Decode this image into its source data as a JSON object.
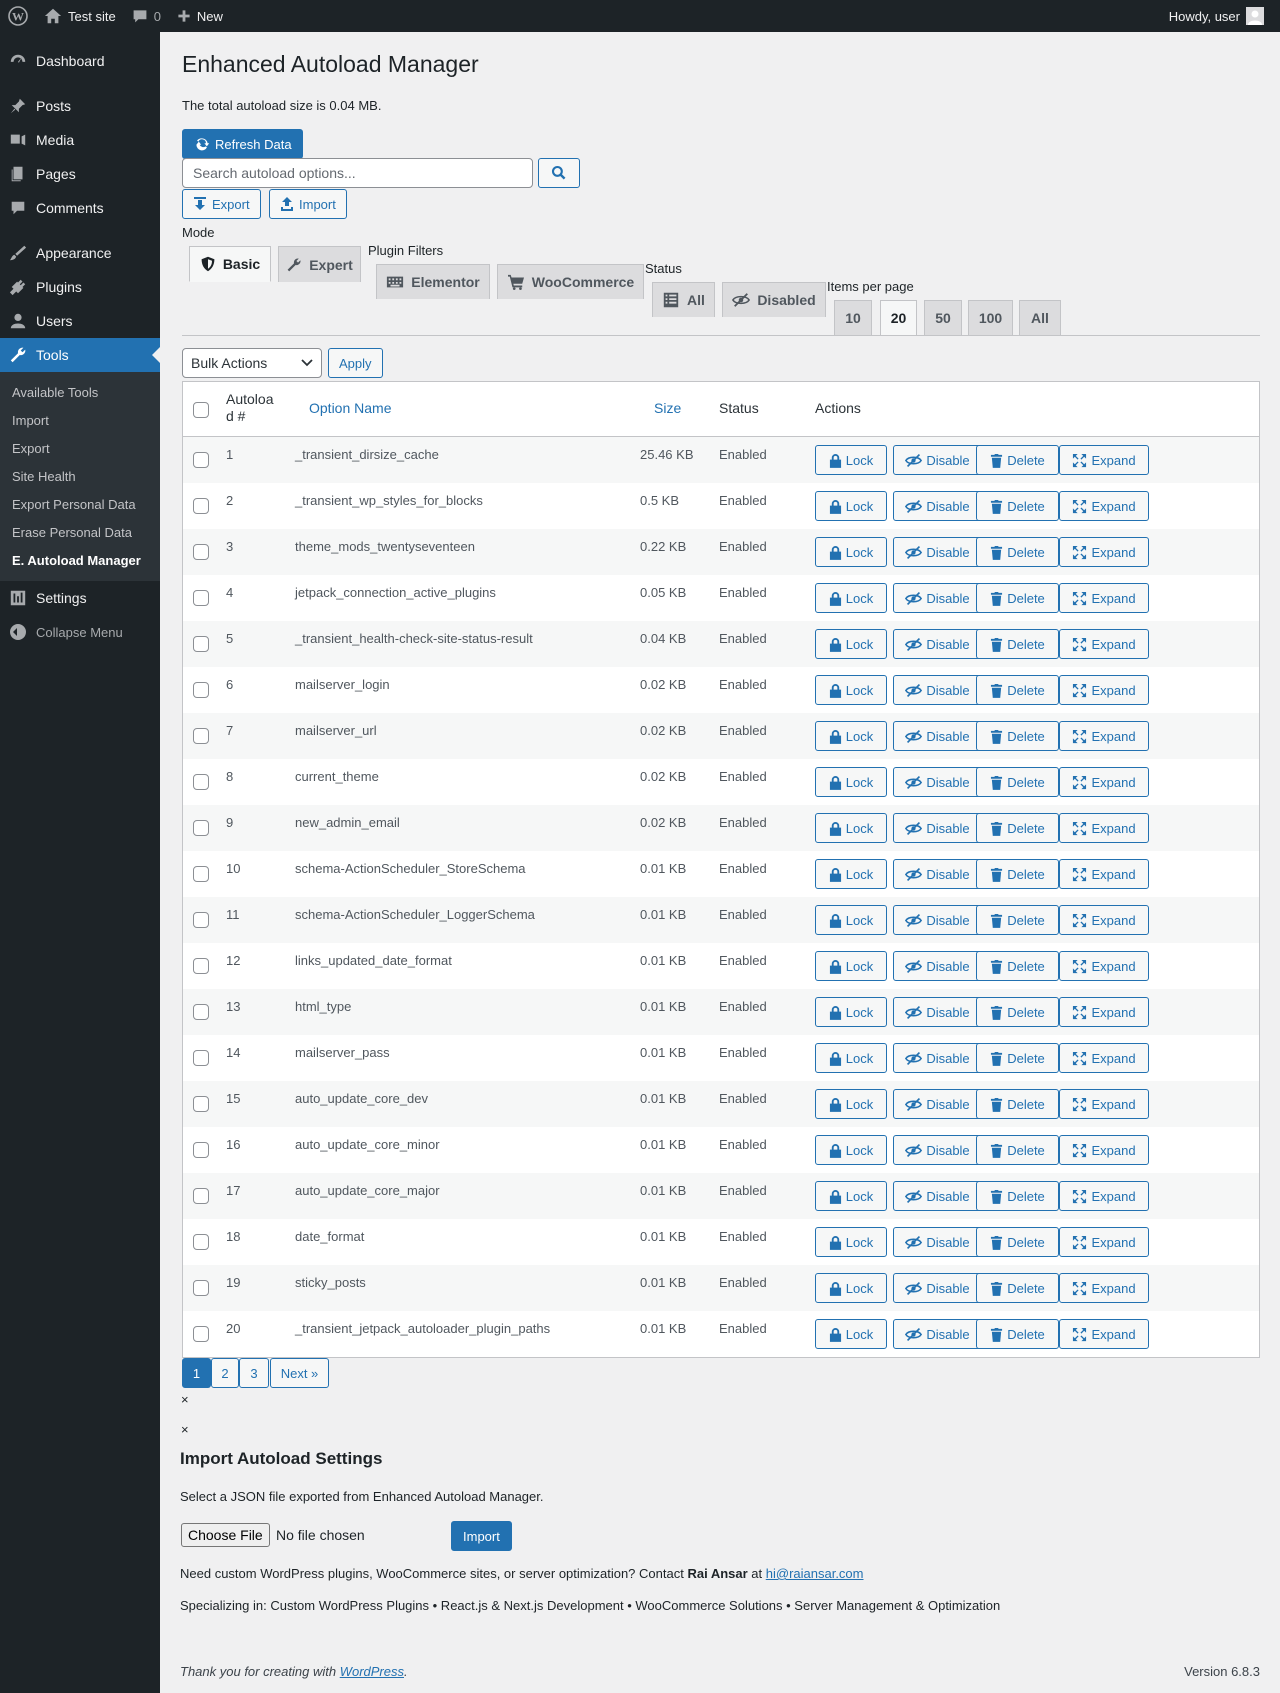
{
  "admin_bar": {
    "site_name": "Test site",
    "comments_count": "0",
    "new_label": "New",
    "howdy": "Howdy, user"
  },
  "sidebar": {
    "items": [
      {
        "label": "Dashboard",
        "icon": "dashboard-icon"
      },
      {
        "label": "Posts",
        "icon": "pin-icon"
      },
      {
        "label": "Media",
        "icon": "media-icon"
      },
      {
        "label": "Pages",
        "icon": "pages-icon"
      },
      {
        "label": "Comments",
        "icon": "comment-icon"
      },
      {
        "label": "Appearance",
        "icon": "brush-icon"
      },
      {
        "label": "Plugins",
        "icon": "plug-icon"
      },
      {
        "label": "Users",
        "icon": "user-icon"
      },
      {
        "label": "Tools",
        "icon": "wrench-icon"
      },
      {
        "label": "Settings",
        "icon": "settings-icon"
      }
    ],
    "submenu": [
      "Available Tools",
      "Import",
      "Export",
      "Site Health",
      "Export Personal Data",
      "Erase Personal Data",
      "E. Autoload Manager"
    ],
    "collapse": "Collapse Menu"
  },
  "page": {
    "title": "Enhanced Autoload Manager",
    "total_size": "The total autoload size is 0.04 MB.",
    "refresh": "Refresh Data",
    "search_placeholder": "Search autoload options...",
    "export": "Export",
    "import": "Import",
    "mode_label": "Mode",
    "mode_tabs": [
      "Basic",
      "Expert"
    ],
    "plugin_filters_label": "Plugin Filters",
    "plugin_tabs": [
      "Elementor",
      "WooCommerce"
    ],
    "status_label": "Status",
    "status_tabs": [
      "All",
      "Disabled"
    ],
    "per_page_label": "Items per page",
    "per_page_tabs": [
      "10",
      "20",
      "50",
      "100",
      "All"
    ],
    "bulk_actions": "Bulk Actions",
    "apply": "Apply"
  },
  "table": {
    "headers": {
      "num_line1": "Autoloa",
      "num_line2": "d #",
      "name": "Option Name",
      "size": "Size",
      "status": "Status",
      "actions": "Actions"
    },
    "action_labels": [
      "Lock",
      "Disable",
      "Delete",
      "Expand"
    ],
    "rows": [
      {
        "num": "1",
        "name": "_transient_dirsize_cache",
        "size": "25.46 KB",
        "status": "Enabled"
      },
      {
        "num": "2",
        "name": "_transient_wp_styles_for_blocks",
        "size": "0.5 KB",
        "status": "Enabled"
      },
      {
        "num": "3",
        "name": "theme_mods_twentyseventeen",
        "size": "0.22 KB",
        "status": "Enabled"
      },
      {
        "num": "4",
        "name": "jetpack_connection_active_plugins",
        "size": "0.05 KB",
        "status": "Enabled"
      },
      {
        "num": "5",
        "name": "_transient_health-check-site-status-result",
        "size": "0.04 KB",
        "status": "Enabled"
      },
      {
        "num": "6",
        "name": "mailserver_login",
        "size": "0.02 KB",
        "status": "Enabled"
      },
      {
        "num": "7",
        "name": "mailserver_url",
        "size": "0.02 KB",
        "status": "Enabled"
      },
      {
        "num": "8",
        "name": "current_theme",
        "size": "0.02 KB",
        "status": "Enabled"
      },
      {
        "num": "9",
        "name": "new_admin_email",
        "size": "0.02 KB",
        "status": "Enabled"
      },
      {
        "num": "10",
        "name": "schema-ActionScheduler_StoreSchema",
        "size": "0.01 KB",
        "status": "Enabled"
      },
      {
        "num": "11",
        "name": "schema-ActionScheduler_LoggerSchema",
        "size": "0.01 KB",
        "status": "Enabled"
      },
      {
        "num": "12",
        "name": "links_updated_date_format",
        "size": "0.01 KB",
        "status": "Enabled"
      },
      {
        "num": "13",
        "name": "html_type",
        "size": "0.01 KB",
        "status": "Enabled"
      },
      {
        "num": "14",
        "name": "mailserver_pass",
        "size": "0.01 KB",
        "status": "Enabled"
      },
      {
        "num": "15",
        "name": "auto_update_core_dev",
        "size": "0.01 KB",
        "status": "Enabled"
      },
      {
        "num": "16",
        "name": "auto_update_core_minor",
        "size": "0.01 KB",
        "status": "Enabled"
      },
      {
        "num": "17",
        "name": "auto_update_core_major",
        "size": "0.01 KB",
        "status": "Enabled"
      },
      {
        "num": "18",
        "name": "date_format",
        "size": "0.01 KB",
        "status": "Enabled"
      },
      {
        "num": "19",
        "name": "sticky_posts",
        "size": "0.01 KB",
        "status": "Enabled"
      },
      {
        "num": "20",
        "name": "_transient_jetpack_autoloader_plugin_paths",
        "size": "0.01 KB",
        "status": "Enabled"
      }
    ]
  },
  "pagination": [
    "1",
    "2",
    "3",
    "Next »"
  ],
  "close_mark": "×",
  "import_section": {
    "title": "Import Autoload Settings",
    "desc": "Select a JSON file exported from Enhanced Autoload Manager.",
    "choose": "Choose File",
    "no_file": "No file chosen",
    "button": "Import"
  },
  "contact": {
    "prefix": "Need custom WordPress plugins, WooCommerce sites, or server optimization? Contact ",
    "name": "Rai Ansar",
    "at": " at ",
    "email": "hi@raiansar.com"
  },
  "specializing": "Specializing in: Custom WordPress Plugins • React.js & Next.js Development • WooCommerce Solutions • Server Management & Optimization",
  "footer": {
    "prefix": "Thank you for creating with ",
    "link": "WordPress",
    "suffix": ".",
    "version": "Version 6.8.3"
  },
  "colors": {
    "accent": "#2271b1",
    "sidebar": "#1d2327",
    "background": "#f0f0f1"
  }
}
